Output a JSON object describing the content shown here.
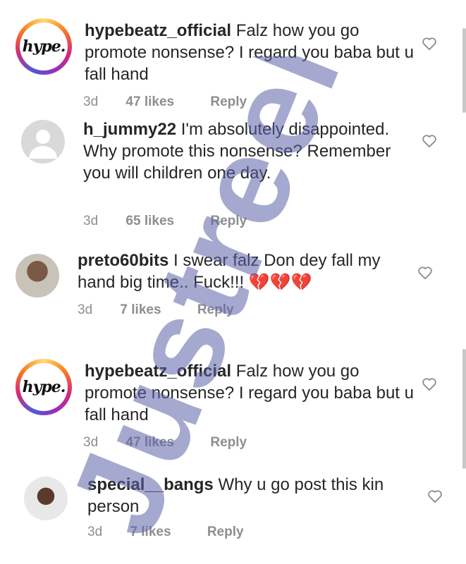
{
  "comments": [
    {
      "username": "hypebeatz_official",
      "text": "Falz how you go promote nonsense? I regard you baba but u fall hand",
      "time": "3d",
      "likes": "47 likes",
      "reply": "Reply",
      "avatar_icon": "hype-logo-avatar",
      "avatar_text": "hype."
    },
    {
      "username": "h_jummy22",
      "text": "I'm absolutely disappointed. Why promote this nonsense? Remember you will children one day.",
      "time": "3d",
      "likes": "65 likes",
      "reply": "Reply",
      "avatar_icon": "default-avatar"
    },
    {
      "username": "preto60bits",
      "text": "I swear falz Don dey fall my hand big time.. Fuck!!! 💔💔💔",
      "time": "3d",
      "likes": "7 likes",
      "reply": "Reply",
      "avatar_icon": "photo-avatar"
    },
    {
      "username": "hypebeatz_official",
      "text": "Falz how you go promote nonsense? I regard you baba but u fall hand",
      "time": "3d",
      "likes": "47 likes",
      "reply": "Reply",
      "avatar_icon": "hype-logo-avatar",
      "avatar_text": "hype."
    },
    {
      "username": "special__bangs",
      "text": "Why u go post this kin person",
      "time": "3d",
      "likes": "7 likes",
      "reply": "Reply",
      "avatar_icon": "photo-avatar"
    }
  ],
  "watermark": "Justreel",
  "colors": {
    "text": "#262626",
    "meta": "#8e8e8e",
    "watermark": "#5b63a8"
  }
}
